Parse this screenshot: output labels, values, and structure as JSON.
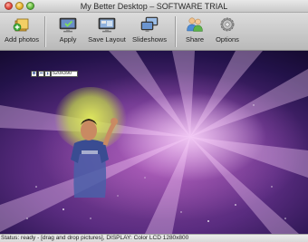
{
  "window": {
    "title": "My Better Desktop – SOFTWARE TRIAL"
  },
  "toolbar": {
    "items": [
      {
        "label": "Add photos",
        "icon": "add-photos-icon"
      },
      {
        "label": "Apply",
        "icon": "apply-icon"
      },
      {
        "label": "Save Layout",
        "icon": "save-layout-icon"
      },
      {
        "label": "Slideshows",
        "icon": "slideshows-icon"
      },
      {
        "label": "Share",
        "icon": "share-icon"
      },
      {
        "label": "Options",
        "icon": "options-icon"
      }
    ]
  },
  "photo_overlay": {
    "size_value": "520x390"
  },
  "status": {
    "text": "Status: ready - [drag and drop pictures], DISPLAY: Color LCD 1280x800"
  },
  "colors": {
    "desktop_center": "#8e4aa0",
    "desktop_edge": "#140a2e",
    "glow": "#e4f05a"
  }
}
